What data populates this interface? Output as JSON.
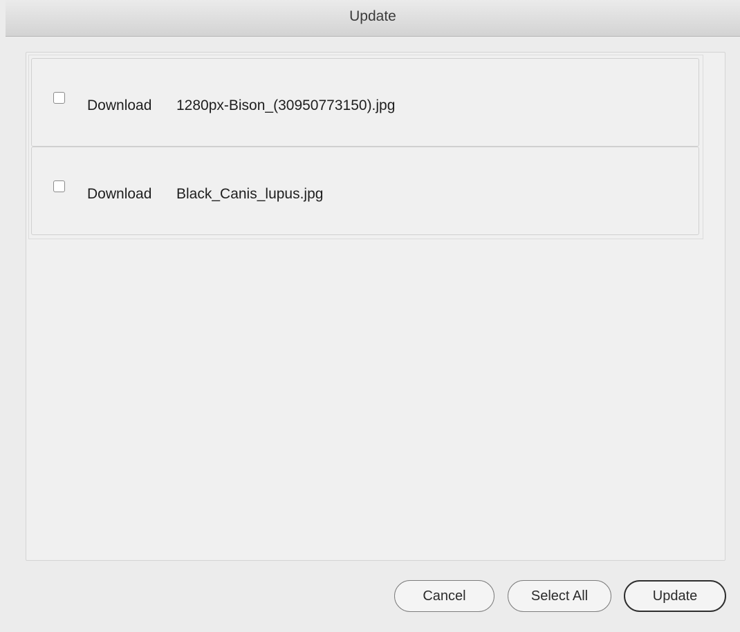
{
  "window": {
    "title": "Update"
  },
  "list": {
    "items": [
      {
        "checked": false,
        "action": "Download",
        "filename": "1280px-Bison_(30950773150).jpg"
      },
      {
        "checked": false,
        "action": "Download",
        "filename": "Black_Canis_lupus.jpg"
      }
    ]
  },
  "buttons": {
    "cancel": "Cancel",
    "select_all": "Select All",
    "update": "Update"
  }
}
